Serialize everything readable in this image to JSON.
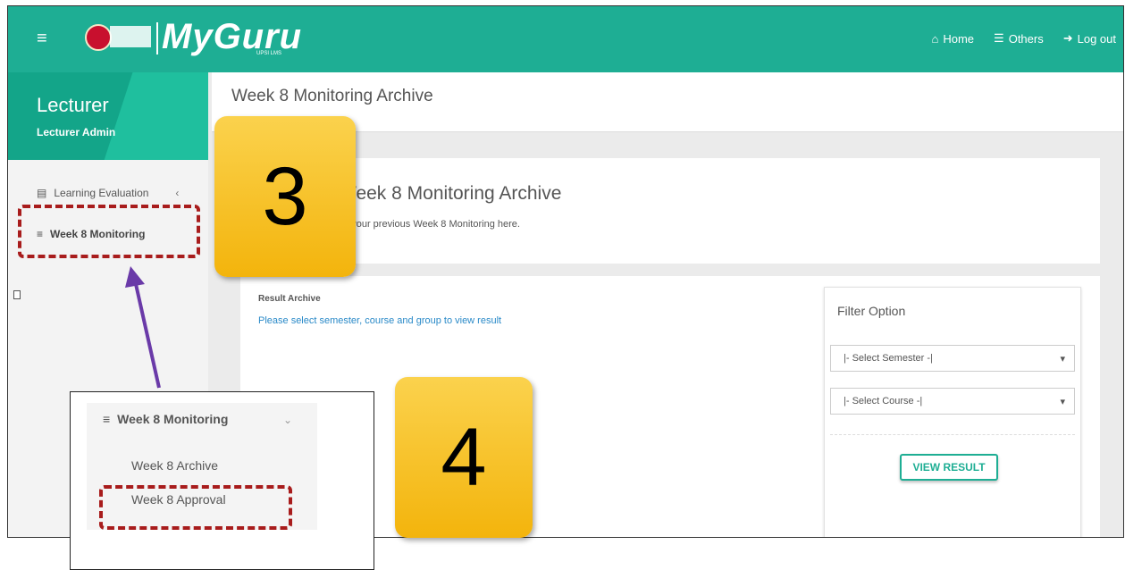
{
  "topbar": {
    "menu_icon": "hamburger-icon",
    "brand": "MyGuru",
    "brand_sub": "UPSI LMS",
    "nav": [
      {
        "label": "Home",
        "icon": "home-icon"
      },
      {
        "label": "Others",
        "icon": "database-icon"
      },
      {
        "label": "Log out",
        "icon": "logout-icon"
      }
    ]
  },
  "sidebar": {
    "role": "Lecturer",
    "user": "Lecturer Admin",
    "items": [
      {
        "label": "Learning Evaluation",
        "icon": "table-icon"
      },
      {
        "label": "Week 8 Monitoring",
        "icon": "sliders-icon"
      }
    ]
  },
  "page": {
    "header": "Week 8 Monitoring Archive",
    "info_title": "Week 8 Monitoring Archive",
    "info_text": "et your previous Week 8 Monitoring here."
  },
  "result": {
    "title": "Result Archive",
    "message": "Please select semester, course and group to view result"
  },
  "filter": {
    "title": "Filter Option",
    "semester": "|- Select Semester -|",
    "course": "|- Select Course -|",
    "button": "VIEW RESULT"
  },
  "callouts": {
    "step3": "3",
    "step4": "4"
  },
  "inset": {
    "heading": "Week 8 Monitoring",
    "item1": "Week 8 Archive",
    "item2": "Week 8 Approval"
  },
  "colors": {
    "brand": "#1eae94",
    "highlight": "#a81c1c",
    "arrow": "#6a3aa8",
    "callout": "#f7c325"
  }
}
